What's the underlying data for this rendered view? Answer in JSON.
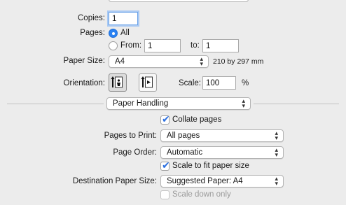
{
  "copies": {
    "label": "Copies:",
    "value": "1"
  },
  "pages": {
    "label": "Pages:",
    "all_label": "All",
    "from_label": "From:",
    "from_value": "1",
    "to_label": "to:",
    "to_value": "1"
  },
  "paper_size": {
    "label": "Paper Size:",
    "value": "A4",
    "dimensions": "210 by 297 mm"
  },
  "orientation": {
    "label": "Orientation:",
    "selected": "portrait"
  },
  "scale": {
    "label": "Scale:",
    "value": "100",
    "unit": "%"
  },
  "section_popup": {
    "value": "Paper Handling"
  },
  "collate": {
    "label": "Collate pages",
    "checked": true
  },
  "pages_to_print": {
    "label": "Pages to Print:",
    "value": "All pages"
  },
  "page_order": {
    "label": "Page Order:",
    "value": "Automatic"
  },
  "scale_to_fit": {
    "label": "Scale to fit paper size",
    "checked": true
  },
  "destination": {
    "label": "Destination Paper Size:",
    "value": "Suggested Paper: A4"
  },
  "scale_down": {
    "label": "Scale down only",
    "checked": false,
    "disabled": true
  },
  "colors": {
    "accent": "#2b82f2",
    "focus_ring": "#a9c9f3",
    "background": "#ececec"
  }
}
